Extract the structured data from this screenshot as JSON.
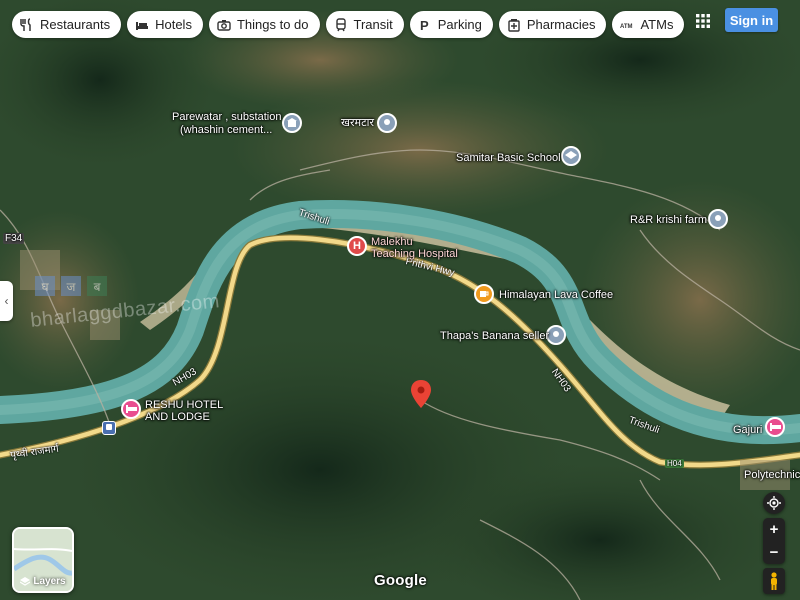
{
  "chips": [
    {
      "label": "Restaurants",
      "icon": "fork-knife-icon"
    },
    {
      "label": "Hotels",
      "icon": "bed-icon"
    },
    {
      "label": "Things to do",
      "icon": "camera-icon"
    },
    {
      "label": "Transit",
      "icon": "train-icon"
    },
    {
      "label": "Parking",
      "icon": "parking-icon"
    },
    {
      "label": "Pharmacies",
      "icon": "pharmacy-icon"
    },
    {
      "label": "ATMs",
      "icon": "atm-icon"
    }
  ],
  "header": {
    "signin_label": "Sign in",
    "apps_icon": "apps-grid-icon"
  },
  "controls": {
    "layers_label": "Layers",
    "zoom_in": "+",
    "zoom_out": "−",
    "locate_icon": "my-location-icon",
    "pegman_icon": "pegman-icon",
    "collapse_icon": "chevron-left-icon"
  },
  "branding": "Google",
  "watermark": "bharlaggdbazar.com",
  "places": {
    "parewatar_1": "Parewatar , substation",
    "parewatar_2": "(whashin cement...",
    "kharmatar": "खरमटार",
    "samitar": "Samitar Basic School",
    "rr_krishi": "R&R krishi farm",
    "malekhu_1": "Malekhu",
    "malekhu_2": "Teaching Hospital",
    "himalayan": "Himalayan Lava Coffee",
    "thapa": "Thapa's Banana seller",
    "reshu_1": "RESHU HOTEL",
    "reshu_2": "AND LODGE",
    "gajuri": "Gajuri",
    "polytechnic": "Polytechnic"
  },
  "roads": {
    "f34": "F34",
    "prithvi_hwy": "Prithvi Hwy",
    "nh03_a": "NH03",
    "nh03_b": "NH03",
    "h04": "H04",
    "prithvi_rajmarg": "पृथ्वी राजमार्ग"
  },
  "rivers": {
    "trishuli_a": "Trishuli",
    "trishuli_b": "Trishuli"
  },
  "colors": {
    "signin": "#4a90e2",
    "river": "#5fa7a0",
    "highway": "#f2d98a",
    "pin": "#ea4335",
    "hotel_pin": "#e94d8f"
  }
}
